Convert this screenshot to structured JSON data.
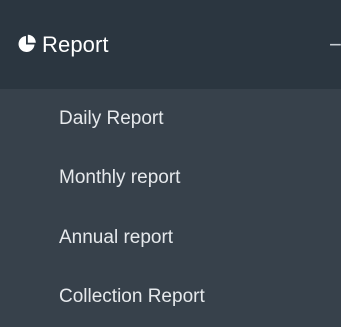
{
  "menu": {
    "header": {
      "icon": "pie-chart-icon",
      "label": "Report",
      "collapse_symbol": "−"
    },
    "items": [
      {
        "label": "Daily Report"
      },
      {
        "label": "Monthly report"
      },
      {
        "label": "Annual report"
      },
      {
        "label": "Collection Report"
      }
    ]
  },
  "colors": {
    "header_bg": "#2b3640",
    "submenu_bg": "#37414b",
    "text": "#ffffff"
  }
}
